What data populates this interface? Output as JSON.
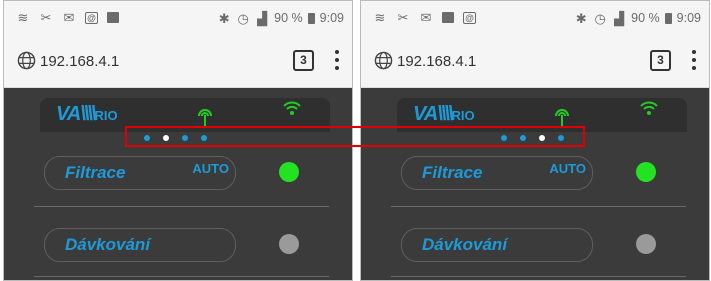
{
  "screens": [
    {
      "status": {
        "battery": "90 %",
        "time": "9:09"
      },
      "url": "192.168.4.1",
      "tab_count": "3",
      "app": {
        "logo_main": "VA",
        "logo_sub": "RIO",
        "active_page_index": 1,
        "page_count": 4,
        "rows": [
          {
            "label": "Filtrace",
            "mode": "AUTO",
            "led_color": "#22e222"
          },
          {
            "label": "Dávkování",
            "mode": "",
            "led_color": "#9a9a9a"
          }
        ]
      }
    },
    {
      "status": {
        "battery": "90 %",
        "time": "9:09"
      },
      "url": "192.168.4.1",
      "tab_count": "3",
      "app": {
        "logo_main": "VA",
        "logo_sub": "RIO",
        "active_page_index": 2,
        "page_count": 4,
        "rows": [
          {
            "label": "Filtrace",
            "mode": "AUTO",
            "led_color": "#22e222"
          },
          {
            "label": "Dávkování",
            "mode": "",
            "led_color": "#9a9a9a"
          }
        ]
      }
    }
  ],
  "colors": {
    "accent": "#1e9ad8",
    "highlight": "#e00000",
    "app_bg": "#3b3b3b"
  },
  "icons": {
    "status_left": [
      "wifi-muted-icon",
      "scissors-icon",
      "mail-icon",
      "at-icon",
      "image-icon"
    ],
    "status_right": [
      "bluetooth-icon",
      "alarm-icon",
      "signal-icon",
      "battery-icon"
    ],
    "browser": [
      "globe-icon",
      "tabs-icon",
      "menu-icon"
    ]
  }
}
